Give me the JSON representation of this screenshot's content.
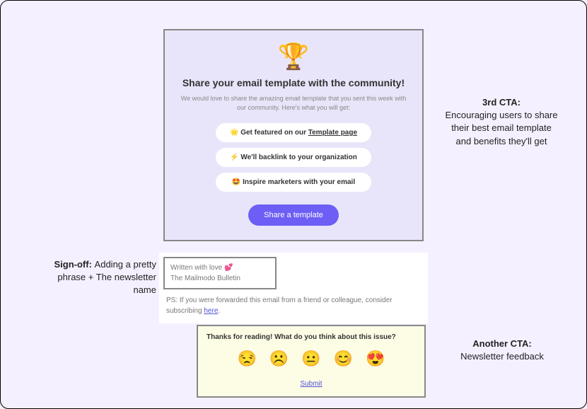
{
  "cta3": {
    "trophy_icon": "🏆",
    "title": "Share your email template with the community!",
    "subtitle": "We would love to share the amazing email template that you sent this week with our community. Here's what you will get:",
    "benefit1_icon": "🌟",
    "benefit1_text": "Get featured on our ",
    "benefit1_link": "Template page",
    "benefit2_icon": "⚡",
    "benefit2_text": "We'll backlink to your organization",
    "benefit3_icon": "🤩",
    "benefit3_text": "Inspire marketers with your email",
    "button_label": "Share a template"
  },
  "annotations": {
    "cta3_label": "3rd CTA:",
    "cta3_desc": "Encouraging users to share their best email template and benefits they'll get",
    "signoff_label": "Sign-off: ",
    "signoff_desc": "Adding a pretty phrase + The newsletter name",
    "another_cta_label": "Another CTA:",
    "another_cta_desc": "Newsletter feedback"
  },
  "signoff": {
    "line1": "Written with love 💕",
    "line2": "The Mailmodo Bulletin"
  },
  "ps": {
    "text": "PS: If you were forwarded this email from a friend or colleague, consider subscribing ",
    "link": "here"
  },
  "feedback": {
    "title": "Thanks for reading! What do you think about this issue?",
    "emoji1": "😒",
    "emoji2": "☹️",
    "emoji3": "😐",
    "emoji4": "😊",
    "emoji5": "😍",
    "submit": "Submit "
  }
}
